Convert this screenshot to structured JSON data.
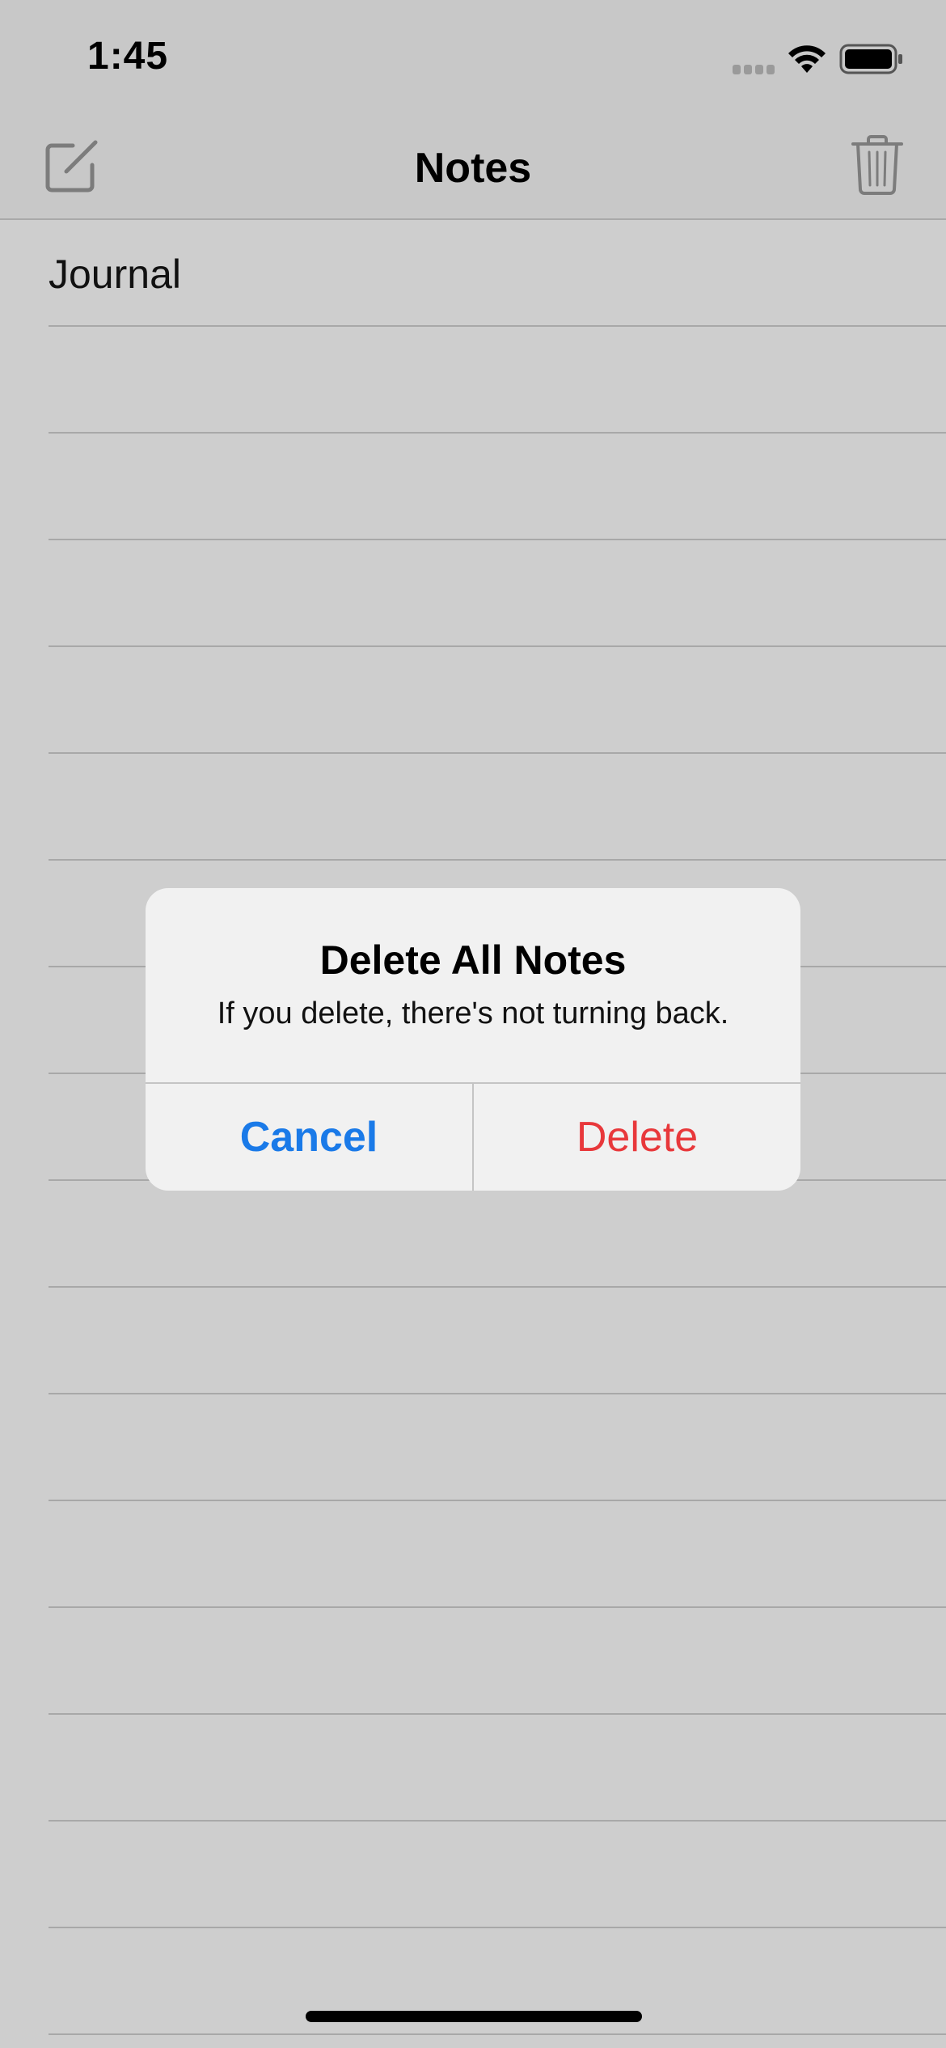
{
  "status_bar": {
    "time": "1:45"
  },
  "nav": {
    "title": "Notes"
  },
  "notes": [
    {
      "title": "Journal"
    }
  ],
  "alert": {
    "title": "Delete All Notes",
    "message": "If you delete, there's not turning back.",
    "cancel_label": "Cancel",
    "delete_label": "Delete"
  },
  "colors": {
    "accent_blue": "#1a7ae8",
    "destructive_red": "#e8383b"
  }
}
